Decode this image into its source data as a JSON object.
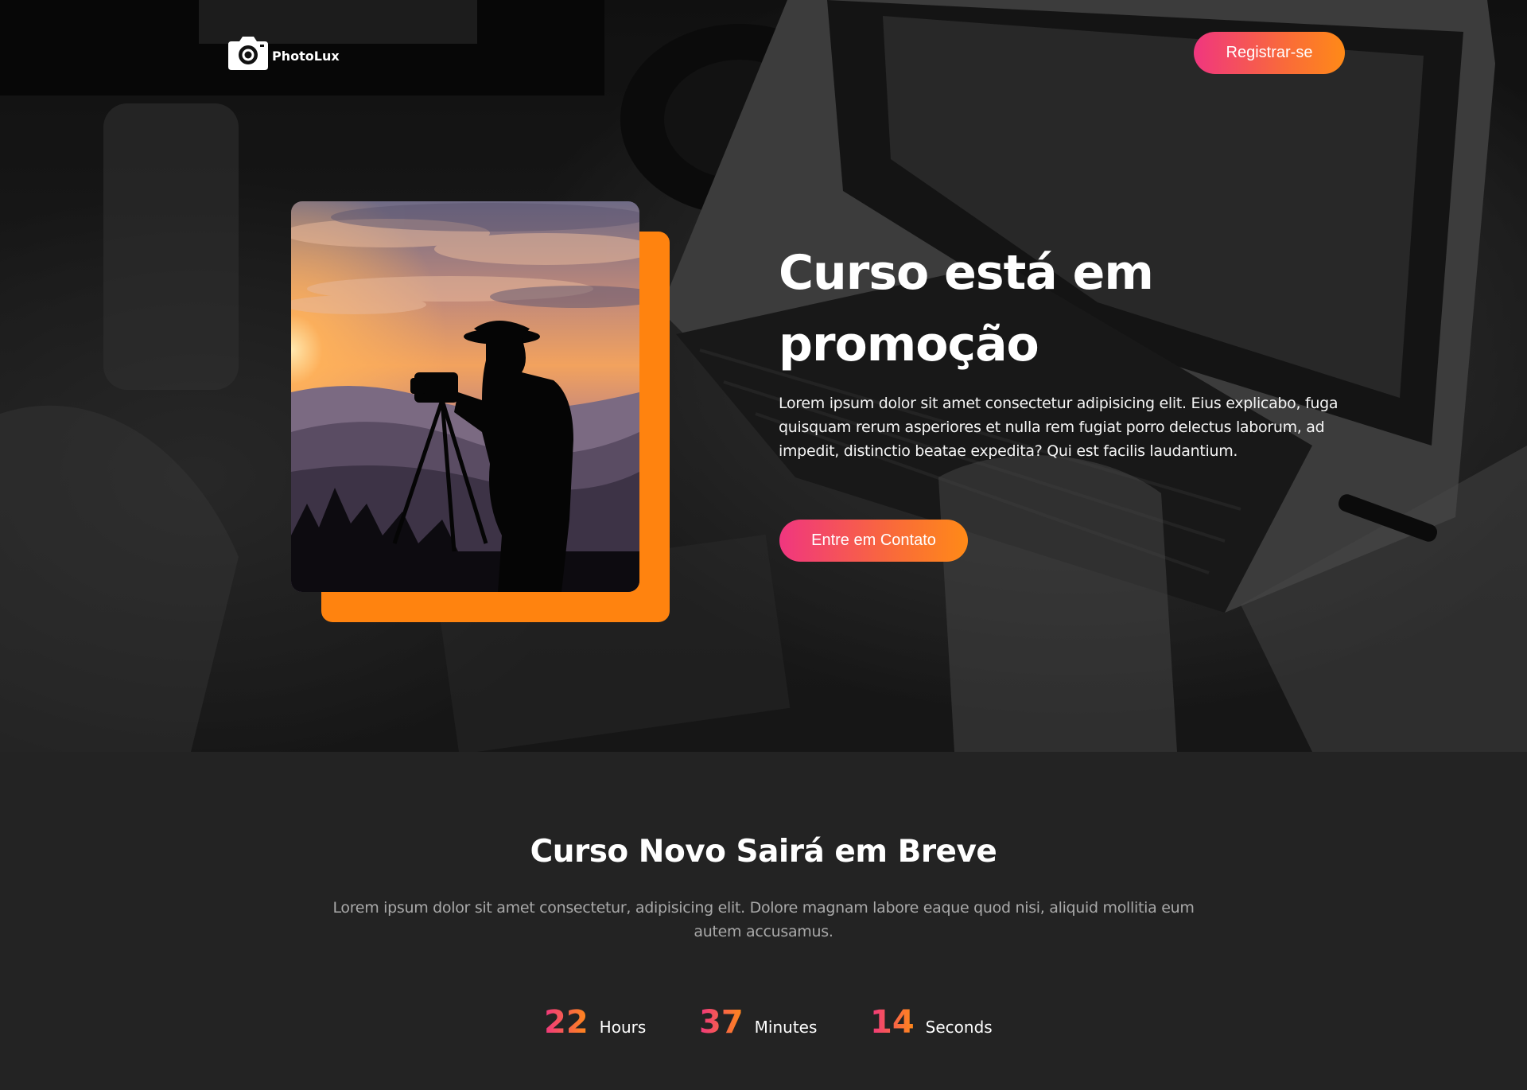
{
  "brand": {
    "name": "PhotoLux"
  },
  "nav": {
    "register_label": "Registrar-se"
  },
  "hero": {
    "title": "Curso está em promoção",
    "text": "Lorem ipsum dolor sit amet consectetur adipisicing elit. Eius explicabo, fuga quisquam rerum asperiores et nulla rem fugiat porro delectus laborum, ad impedit, distinctio beatae expedita? Qui est facilis laudantium.",
    "contact_label": "Entre em Contato"
  },
  "soon": {
    "title": "Curso Novo Sairá em Breve",
    "text": "Lorem ipsum dolor sit amet consectetur, adipisicing elit. Dolore magnam labore eaque quod nisi, aliquid mollitia eum autem accusamus."
  },
  "countdown": [
    {
      "value": "22",
      "label": "Hours"
    },
    {
      "value": "37",
      "label": "Minutes"
    },
    {
      "value": "14",
      "label": "Seconds"
    }
  ],
  "colors": {
    "accent_pink": "#f0367f",
    "accent_orange": "#ff8a17",
    "block_orange": "#ff830f",
    "section_bg": "#232323"
  },
  "icons": {
    "logo": "camera-icon"
  }
}
